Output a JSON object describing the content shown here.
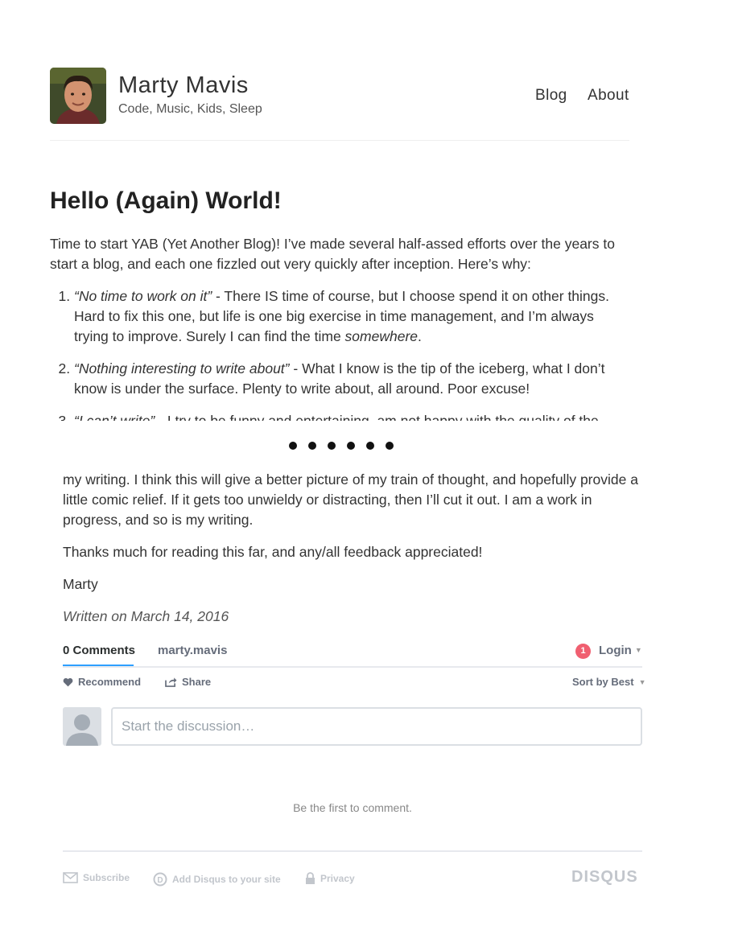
{
  "header": {
    "site_name": "Marty Mavis",
    "site_description": "Code, Music, Kids, Sleep",
    "nav": [
      "Blog",
      "About"
    ]
  },
  "post": {
    "title": "Hello (Again) World!",
    "intro": "Time to start YAB (Yet Another Blog)! I’ve made several half-assed efforts over the years to start a blog, and each one fizzled out very quickly after inception. Here’s why:",
    "reasons": [
      {
        "quote": "“No time to work on it”",
        "dash": " - ",
        "text_before": "There IS time of course, but I choose spend it on other things. Hard to fix this one, but life is one big exercise in time management, and I’m always trying to improve. Surely I can find the time ",
        "emphasis": "somewhere",
        "text_after": "."
      },
      {
        "quote": "“Nothing interesting to write about”",
        "dash": " - ",
        "text": "What I know is the tip of the iceberg, what I don’t know is under the surface. Plenty to write about, all around. Poor excuse!"
      },
      {
        "quote": "“I can’t write”",
        "dash": " - ",
        "text": "I try to be funny and entertaining, am not happy with the quality of the"
      }
    ],
    "continued": "my writing. I think this will give a better picture of my train of thought, and hopefully provide a little comic relief. If it gets too unwieldy or distracting, then I’ll cut it out. I am a work in progress, and so is my writing.",
    "thanks": "Thanks much for reading this far, and any/all feedback appreciated!",
    "signature": "Marty",
    "date": "Written on March 14, 2016"
  },
  "comments": {
    "tab_comments": "0 Comments",
    "tab_user": "marty.mavis",
    "notification_count": "1",
    "login_label": "Login",
    "recommend_label": "Recommend",
    "share_label": "Share",
    "sort_label": "Sort by Best",
    "input_placeholder": "Start the discussion…",
    "empty_message": "Be the first to comment."
  },
  "footer": {
    "subscribe": "Subscribe",
    "add_disqus": "Add Disqus to your site",
    "privacy": "Privacy",
    "logo": "DISQUS"
  },
  "colors": {
    "accent_blue": "#2e9fff",
    "badge_red": "#f05f70",
    "muted_gray": "#656c7a"
  }
}
